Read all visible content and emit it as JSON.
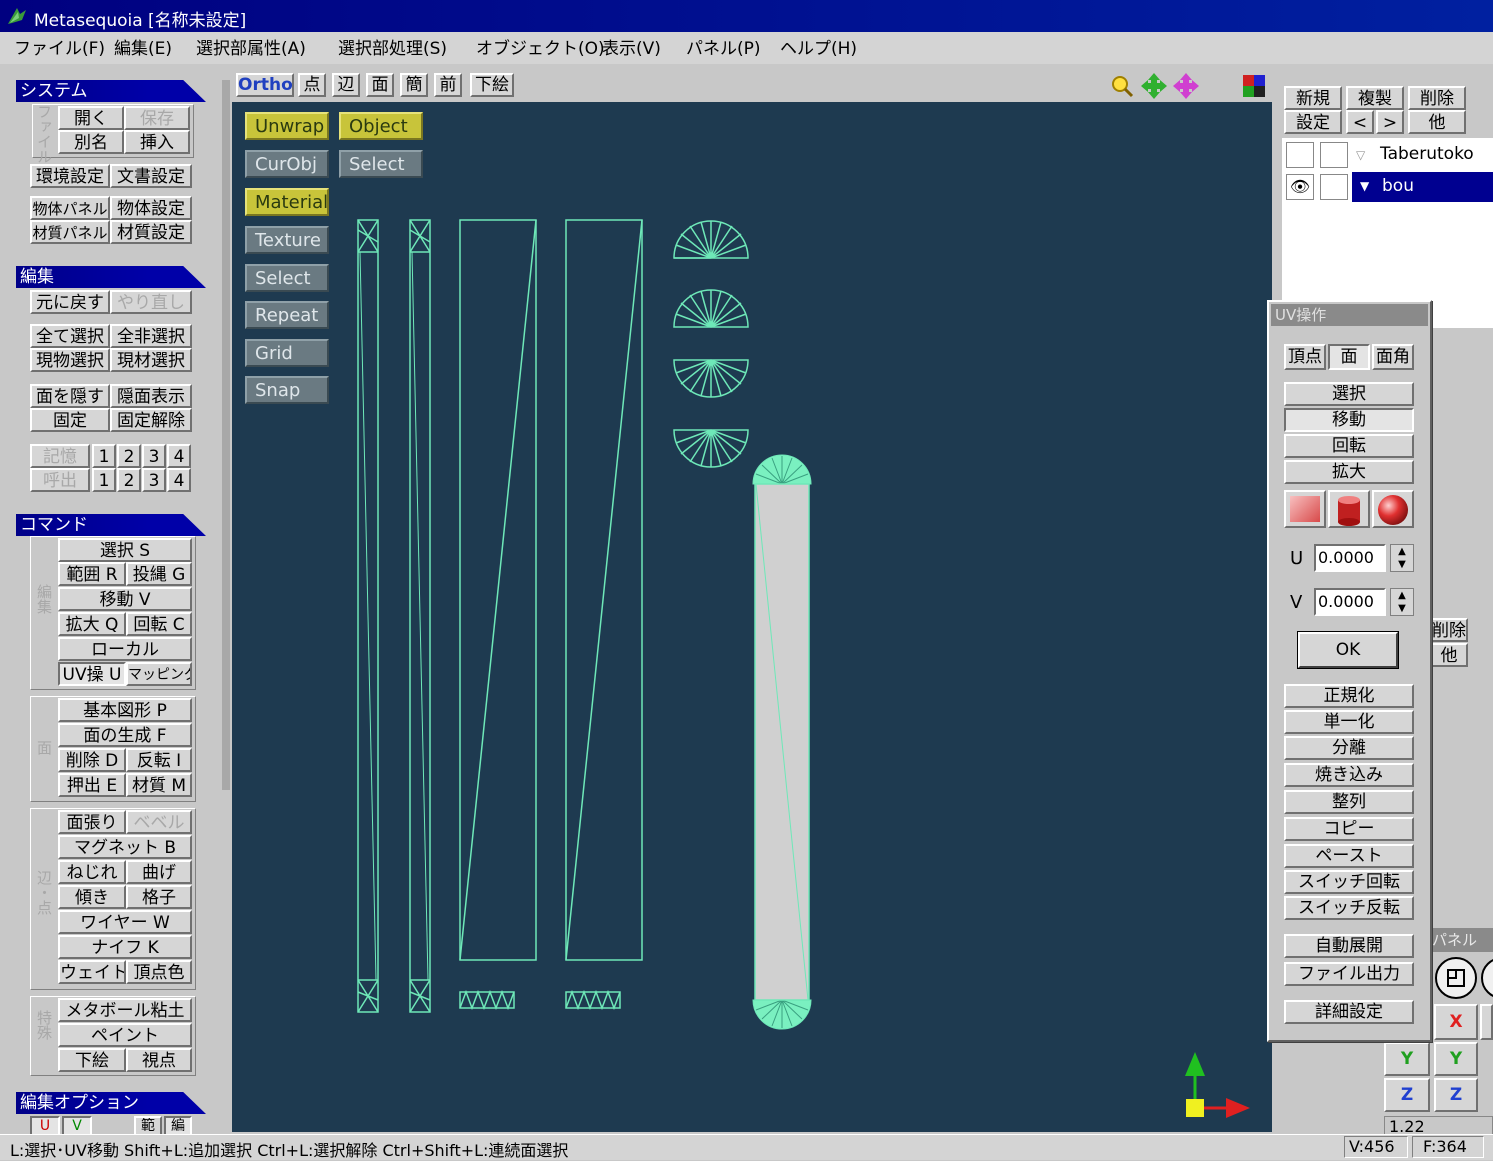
{
  "window": {
    "title": "Metasequoia [名称未設定]"
  },
  "menu": [
    "ファイル(F)",
    "編集(E)",
    "選択部属性(A)",
    "選択部処理(S)",
    "オブジェクト(O)",
    "表示(V)",
    "パネル(P)",
    "ヘルプ(H)"
  ],
  "system": {
    "title": "システム",
    "side_label": "ファイル",
    "open": "開く",
    "save": "保存",
    "saveas": "別名",
    "insert": "挿入",
    "env": "環境設定",
    "doc": "文書設定",
    "objpanel": "物体パネル",
    "objset": "物体設定",
    "matpanel": "材質パネル",
    "matset": "材質設定"
  },
  "edit": {
    "title": "編集",
    "undo": "元に戻す",
    "redo": "やり直し",
    "selall": "全て選択",
    "selnone": "全非選択",
    "curobj": "現物選択",
    "curmat": "現材選択",
    "hide": "面を隠す",
    "show": "隠面表示",
    "fix": "固定",
    "unfix": "固定解除",
    "memory": "記憶",
    "recall": "呼出",
    "nums": [
      "1",
      "2",
      "3",
      "4"
    ]
  },
  "command": {
    "title": "コマンド",
    "group1_label": "編集",
    "select": "選択 S",
    "range": "範囲 R",
    "lasso": "投縄 G",
    "move": "移動 V",
    "scale": "拡大 Q",
    "rotate": "回転 C",
    "local": "ローカル",
    "uv": "UV操 U",
    "mapping": "マッピング",
    "group2_label": "面",
    "primitive": "基本図形 P",
    "makeface": "面の生成 F",
    "delete": "削除 D",
    "flip": "反転 I",
    "extrude": "押出 E",
    "material": "材質 M",
    "group3_label": "辺・点",
    "facing": "面張り",
    "bevel": "ベベル",
    "magnet": "マグネット B",
    "twist": "ねじれ",
    "bend": "曲げ",
    "tilt": "傾き",
    "lattice": "格子",
    "wire": "ワイヤー W",
    "knife": "ナイフ K",
    "weight": "ウェイト",
    "vcolor": "頂点色",
    "group4_label": "特殊",
    "metaball": "メタボール粘土",
    "paint": "ペイント",
    "underlay": "下絵",
    "viewpoint": "視点"
  },
  "editopt": {
    "title": "編集オプション",
    "u": "U",
    "v": "V",
    "range": "範",
    "w": "編"
  },
  "viewport": {
    "mode": "Ortho",
    "tabs": [
      "点",
      "辺",
      "面",
      "簡",
      "前",
      "下絵"
    ],
    "toggles": [
      {
        "label": "Unwrap",
        "on": true
      },
      {
        "label": "Object",
        "on": true
      },
      {
        "label": "CurObj",
        "on": false
      },
      {
        "label": "Select",
        "on": false
      },
      {
        "label": "Material",
        "on": true
      },
      {
        "label": "Texture",
        "on": false
      },
      {
        "label": "Select",
        "on": false
      },
      {
        "label": "Repeat",
        "on": false
      },
      {
        "label": "Grid",
        "on": false
      },
      {
        "label": "Snap",
        "on": false
      }
    ],
    "bg": "#1e3a50",
    "wire": "#6ee8b8"
  },
  "object_panel": {
    "new": "新規",
    "dup": "複製",
    "del": "削除",
    "settings": "設定",
    "prev": "<",
    "next": ">",
    "other": "他",
    "objects": [
      {
        "name": "Taberutoko",
        "selected": false
      },
      {
        "name": "bou",
        "selected": true
      }
    ]
  },
  "uv_panel": {
    "title": "UV操作",
    "modes": [
      "頂点",
      "面",
      "面角"
    ],
    "select": "選択",
    "move": "移動",
    "rotate": "回転",
    "scale": "拡大",
    "u_label": "U",
    "u_value": "0.0000",
    "v_label": "V",
    "v_value": "0.0000",
    "ok": "OK",
    "normalize": "正規化",
    "unify": "単一化",
    "separate": "分離",
    "bake": "焼き込み",
    "align": "整列",
    "copy": "コピー",
    "paste": "ペースト",
    "switch_rot": "スイッチ回転",
    "switch_flip": "スイッチ反転",
    "auto_unwrap": "自動展開",
    "file_out": "ファイル出力",
    "detail": "詳細設定"
  },
  "right_behind": {
    "del": "削除",
    "other": "他",
    "panel": "パネル",
    "x": "X",
    "y": "Y",
    "z": "Z",
    "scale": "1.22",
    "v_readout": "V:456",
    "f_readout": "F:364"
  },
  "status": "L:選択･UV移動  Shift+L:追加選択  Ctrl+L:選択解除  Ctrl+Shift+L:連続面選択"
}
